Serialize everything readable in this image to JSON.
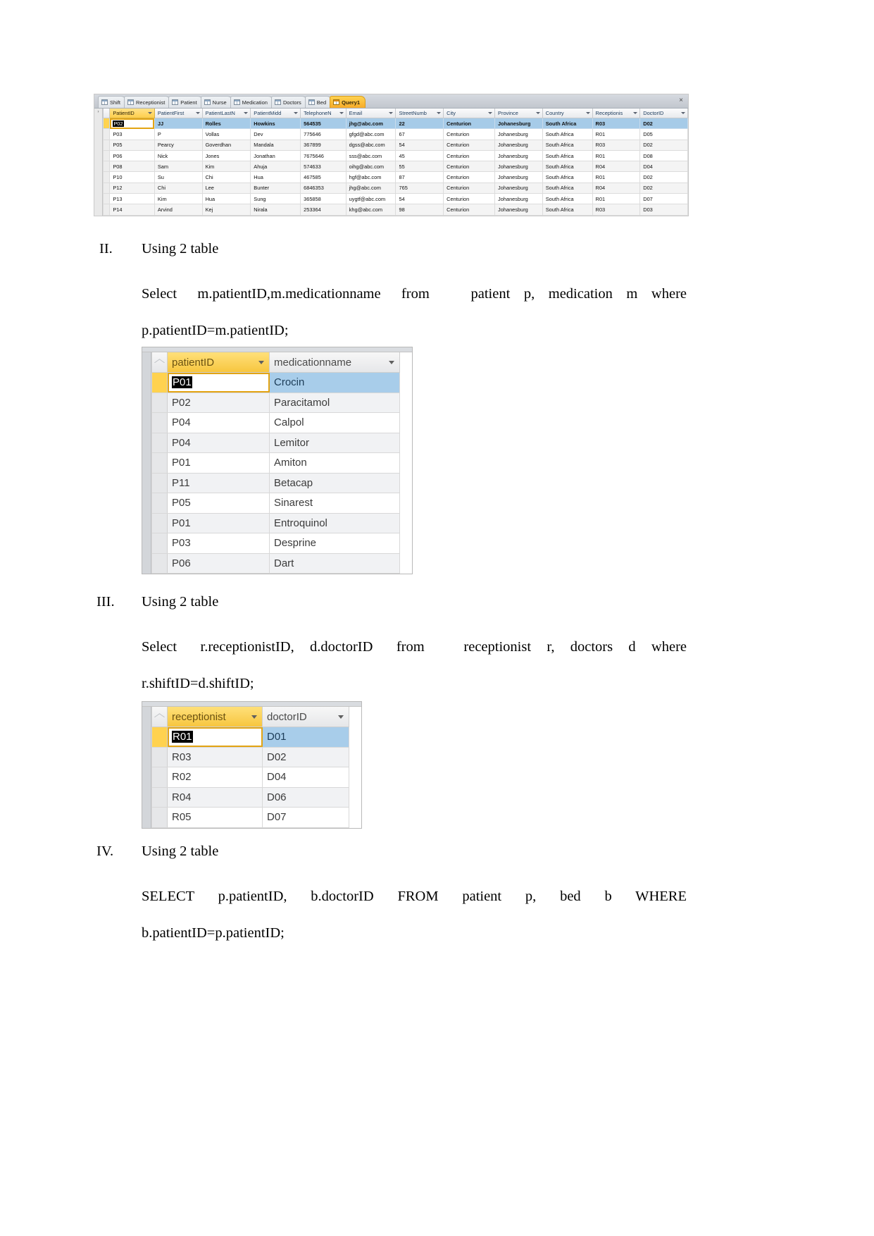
{
  "document": {
    "sections": [
      {
        "numeral": "II.",
        "heading": "Using 2 table",
        "query_line1": "Select   m.patientID,m.medicationname   from      patient  p,  medication  m  where",
        "query_line2": "p.patientID=m.patientID;"
      },
      {
        "numeral": "III.",
        "heading": "Using 2 table",
        "query_line1": "Select   r.receptionistID,  d.doctorID   from     receptionist  r,  doctors  d  where",
        "query_line2": "r.shiftID=d.shiftID;"
      },
      {
        "numeral": "IV.",
        "heading": "Using 2 table",
        "query_line1": "SELECT   p.patientID,   b.doctorID   FROM   patient   p,   bed   b   WHERE",
        "query_line2": "b.patientID=p.patientID;"
      }
    ]
  },
  "access_patient_window": {
    "tabs": [
      {
        "label": "Shift",
        "active": false
      },
      {
        "label": "Receptionist",
        "active": false
      },
      {
        "label": "Patient",
        "active": false
      },
      {
        "label": "Nurse",
        "active": false
      },
      {
        "label": "Medication",
        "active": false
      },
      {
        "label": "Doctors",
        "active": false
      },
      {
        "label": "Bed",
        "active": false
      },
      {
        "label": "Query1",
        "active": true
      }
    ],
    "close_label": "×",
    "nav_marker": "›",
    "columns": [
      "PatientID",
      "PatientFirst",
      "PatientLastN",
      "PatientMidd",
      "TelephoneN",
      "Email",
      "StreetNumb",
      "City",
      "Province",
      "Country",
      "Receptionis",
      "DoctorID"
    ],
    "rows": [
      {
        "PatientID": "P02",
        "PatientFirst": "JJ",
        "PatientLastN": "Rolles",
        "PatientMidd": "Howkins",
        "TelephoneN": "564535",
        "Email": "jhg@abc.com",
        "StreetNumb": "22",
        "City": "Centurion",
        "Province": "Johanesburg",
        "Country": "South Africa",
        "Receptionis": "R03",
        "DoctorID": "D02"
      },
      {
        "PatientID": "P03",
        "PatientFirst": "P",
        "PatientLastN": "Vollas",
        "PatientMidd": "Dev",
        "TelephoneN": "775646",
        "Email": "gfgd@abc.com",
        "StreetNumb": "67",
        "City": "Centurion",
        "Province": "Johanesburg",
        "Country": "South Africa",
        "Receptionis": "R01",
        "DoctorID": "D05"
      },
      {
        "PatientID": "P05",
        "PatientFirst": "Pearcy",
        "PatientLastN": "Goverdhan",
        "PatientMidd": "Mandala",
        "TelephoneN": "367899",
        "Email": "dgss@abc.com",
        "StreetNumb": "54",
        "City": "Centurion",
        "Province": "Johanesburg",
        "Country": "South Africa",
        "Receptionis": "R03",
        "DoctorID": "D02"
      },
      {
        "PatientID": "P06",
        "PatientFirst": "Nick",
        "PatientLastN": "Jones",
        "PatientMidd": "Jonathan",
        "TelephoneN": "7675646",
        "Email": "sss@abc.com",
        "StreetNumb": "45",
        "City": "Centurion",
        "Province": "Johanesburg",
        "Country": "South Africa",
        "Receptionis": "R01",
        "DoctorID": "D08"
      },
      {
        "PatientID": "P08",
        "PatientFirst": "Sam",
        "PatientLastN": "Kim",
        "PatientMidd": "Ahuja",
        "TelephoneN": "574633",
        "Email": "oihg@abc.com",
        "StreetNumb": "55",
        "City": "Centurion",
        "Province": "Johanesburg",
        "Country": "South Africa",
        "Receptionis": "R04",
        "DoctorID": "D04"
      },
      {
        "PatientID": "P10",
        "PatientFirst": "Su",
        "PatientLastN": "Chi",
        "PatientMidd": "Hua",
        "TelephoneN": "467585",
        "Email": "hgf@abc.com",
        "StreetNumb": "87",
        "City": "Centurion",
        "Province": "Johanesburg",
        "Country": "South Africa",
        "Receptionis": "R01",
        "DoctorID": "D02"
      },
      {
        "PatientID": "P12",
        "PatientFirst": "Chi",
        "PatientLastN": "Lee",
        "PatientMidd": "Bunter",
        "TelephoneN": "6846353",
        "Email": "jhg@abc.com",
        "StreetNumb": "765",
        "City": "Centurion",
        "Province": "Johanesburg",
        "Country": "South Africa",
        "Receptionis": "R04",
        "DoctorID": "D02"
      },
      {
        "PatientID": "P13",
        "PatientFirst": "Kim",
        "PatientLastN": "Hua",
        "PatientMidd": "Sung",
        "TelephoneN": "365858",
        "Email": "uygtf@abc.com",
        "StreetNumb": "54",
        "City": "Centurion",
        "Province": "Johanesburg",
        "Country": "South Africa",
        "Receptionis": "R01",
        "DoctorID": "D07"
      },
      {
        "PatientID": "P14",
        "PatientFirst": "Arvind",
        "PatientLastN": "Kej",
        "PatientMidd": "Nirala",
        "TelephoneN": "253364",
        "Email": "khg@abc.com",
        "StreetNumb": "98",
        "City": "Centurion",
        "Province": "Johanesburg",
        "Country": "South Africa",
        "Receptionis": "R03",
        "DoctorID": "D03"
      }
    ]
  },
  "medication_result": {
    "columns": [
      "patientID",
      "medicationname"
    ],
    "rows": [
      {
        "patientID": "P01",
        "medicationname": "Crocin"
      },
      {
        "patientID": "P02",
        "medicationname": "Paracitamol"
      },
      {
        "patientID": "P04",
        "medicationname": "Calpol"
      },
      {
        "patientID": "P04",
        "medicationname": "Lemitor"
      },
      {
        "patientID": "P01",
        "medicationname": "Amiton"
      },
      {
        "patientID": "P11",
        "medicationname": "Betacap"
      },
      {
        "patientID": "P05",
        "medicationname": "Sinarest"
      },
      {
        "patientID": "P01",
        "medicationname": "Entroquinol"
      },
      {
        "patientID": "P03",
        "medicationname": "Desprine"
      },
      {
        "patientID": "P06",
        "medicationname": "Dart"
      }
    ]
  },
  "receptionist_result": {
    "columns": [
      "receptionist",
      "doctorID"
    ],
    "rows": [
      {
        "receptionist": "R01",
        "doctorID": "D01"
      },
      {
        "receptionist": "R03",
        "doctorID": "D02"
      },
      {
        "receptionist": "R02",
        "doctorID": "D04"
      },
      {
        "receptionist": "R04",
        "doctorID": "D06"
      },
      {
        "receptionist": "R05",
        "doctorID": "D07"
      }
    ]
  },
  "colors": {
    "accent_yellow": "#ffd24f",
    "selection_blue": "#a6cbe8",
    "tab_bar": "#c9cdd4"
  }
}
